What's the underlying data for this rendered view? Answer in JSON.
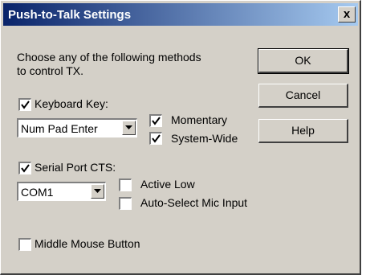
{
  "window": {
    "title": "Push-to-Talk Settings",
    "close_label": "x"
  },
  "buttons": {
    "ok": "OK",
    "cancel": "Cancel",
    "help": "Help"
  },
  "intro": {
    "line1": "Choose any of the following methods",
    "line2": "to control TX."
  },
  "keyboard": {
    "label": "Keyboard Key:",
    "checked": true,
    "key_value": "Num Pad Enter",
    "momentary_label": "Momentary",
    "momentary_checked": true,
    "system_wide_label": "System-Wide",
    "system_wide_checked": true
  },
  "serial": {
    "label": "Serial Port CTS:",
    "checked": true,
    "port_value": "COM1",
    "active_low_label": "Active Low",
    "active_low_checked": false,
    "auto_mic_label": "Auto-Select Mic Input",
    "auto_mic_checked": false
  },
  "mouse": {
    "label": "Middle Mouse Button",
    "checked": false
  },
  "colors": {
    "face": "#d4d0c8",
    "title_start": "#0a246a",
    "title_end": "#a6caf0"
  }
}
